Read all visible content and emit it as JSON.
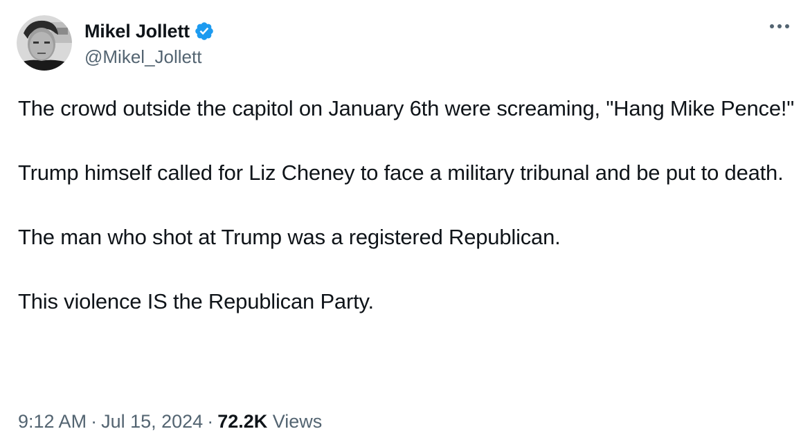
{
  "author": {
    "display_name": "Mikel Jollett",
    "handle": "@Mikel_Jollett",
    "verified": true,
    "verified_color": "#1d9bf0",
    "avatar_icon": "profile-photo-grayscale"
  },
  "more_icon": "more-horizontal-icon",
  "tweet": {
    "paragraphs": [
      "The crowd outside the capitol on January 6th were screaming, \"Hang Mike Pence!\"",
      "Trump himself called for Liz Cheney to face a military tribunal and be put to death.",
      "The man who shot at Trump was a registered Republican.",
      "This violence IS the Republican Party."
    ]
  },
  "meta": {
    "time": "9:12 AM",
    "separator": "·",
    "date": "Jul 15, 2024",
    "views_count": "72.2K",
    "views_label": "Views"
  },
  "colors": {
    "text_primary": "#0f1419",
    "text_secondary": "#536471",
    "background": "#ffffff"
  }
}
